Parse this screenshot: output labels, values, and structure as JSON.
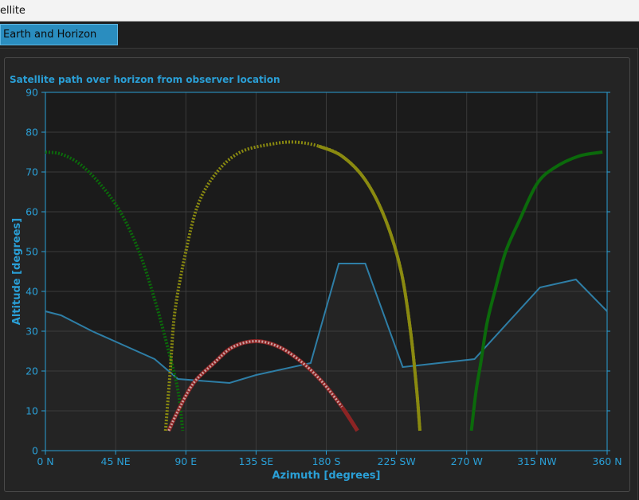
{
  "window": {
    "title": "ellite"
  },
  "tabs": [
    {
      "label": "Earth and Horizon Maps",
      "active": true
    }
  ],
  "group": {
    "title": "Satellite path over horizon from observer location"
  },
  "colors": {
    "accent": "#2a9fd6",
    "horizon_line": "#2e7ea6",
    "green": "#0b6a0b",
    "yellow": "#8a8a10",
    "red": "#8c2424"
  },
  "chart_data": {
    "type": "line",
    "xlabel": "Azimuth [degrees]",
    "ylabel": "Altitude [degrees]",
    "xlim": [
      0,
      360
    ],
    "ylim": [
      0,
      90
    ],
    "grid": true,
    "x_ticks": [
      {
        "value": 0,
        "label": "0 N"
      },
      {
        "value": 45,
        "label": "45 NE"
      },
      {
        "value": 90,
        "label": "90 E"
      },
      {
        "value": 135,
        "label": "135 SE"
      },
      {
        "value": 180,
        "label": "180 S"
      },
      {
        "value": 225,
        "label": "225 SW"
      },
      {
        "value": 270,
        "label": "270 W"
      },
      {
        "value": 315,
        "label": "315 NW"
      },
      {
        "value": 360,
        "label": "360 N"
      }
    ],
    "y_ticks": [
      0,
      10,
      20,
      30,
      40,
      50,
      60,
      70,
      80,
      90
    ],
    "horizon": {
      "x": [
        0,
        10,
        30,
        50,
        70,
        85,
        118,
        135,
        170,
        188,
        205,
        229,
        275,
        317,
        340,
        360
      ],
      "y": [
        35,
        34,
        30,
        26.5,
        23,
        18,
        17,
        19,
        22,
        47,
        47,
        21,
        23,
        41,
        43,
        35
      ]
    },
    "passes": [
      {
        "color": "green",
        "below_horizon_dotted": true,
        "points": [
          [
            273,
            5
          ],
          [
            276,
            15
          ],
          [
            279,
            22
          ],
          [
            283,
            32
          ],
          [
            288,
            40
          ],
          [
            295,
            50
          ],
          [
            304,
            58
          ],
          [
            315,
            67
          ],
          [
            326,
            71
          ],
          [
            342,
            74
          ],
          [
            357,
            75
          ]
        ],
        "points2": [
          [
            0,
            75
          ],
          [
            10,
            74.5
          ],
          [
            22,
            72
          ],
          [
            35,
            67
          ],
          [
            48,
            60
          ],
          [
            60,
            50
          ],
          [
            70,
            38
          ],
          [
            79,
            25
          ],
          [
            85,
            15
          ],
          [
            88,
            5
          ]
        ]
      },
      {
        "color": "yellow",
        "points": [
          [
            77,
            5
          ],
          [
            80,
            20
          ],
          [
            83,
            35
          ],
          [
            90,
            50
          ],
          [
            98,
            62
          ],
          [
            110,
            70
          ],
          [
            125,
            75
          ],
          [
            145,
            77
          ],
          [
            160,
            77.5
          ],
          [
            175,
            76.5
          ],
          [
            190,
            74
          ],
          [
            205,
            68
          ],
          [
            218,
            58
          ],
          [
            228,
            45
          ],
          [
            234,
            30
          ],
          [
            238,
            15
          ],
          [
            240,
            5
          ]
        ]
      },
      {
        "color": "red",
        "points": [
          [
            79,
            5
          ],
          [
            85,
            10
          ],
          [
            95,
            17
          ],
          [
            108,
            22
          ],
          [
            120,
            26
          ],
          [
            135,
            27.5
          ],
          [
            150,
            26
          ],
          [
            165,
            22
          ],
          [
            178,
            17
          ],
          [
            190,
            11
          ],
          [
            200,
            5
          ]
        ]
      }
    ]
  }
}
